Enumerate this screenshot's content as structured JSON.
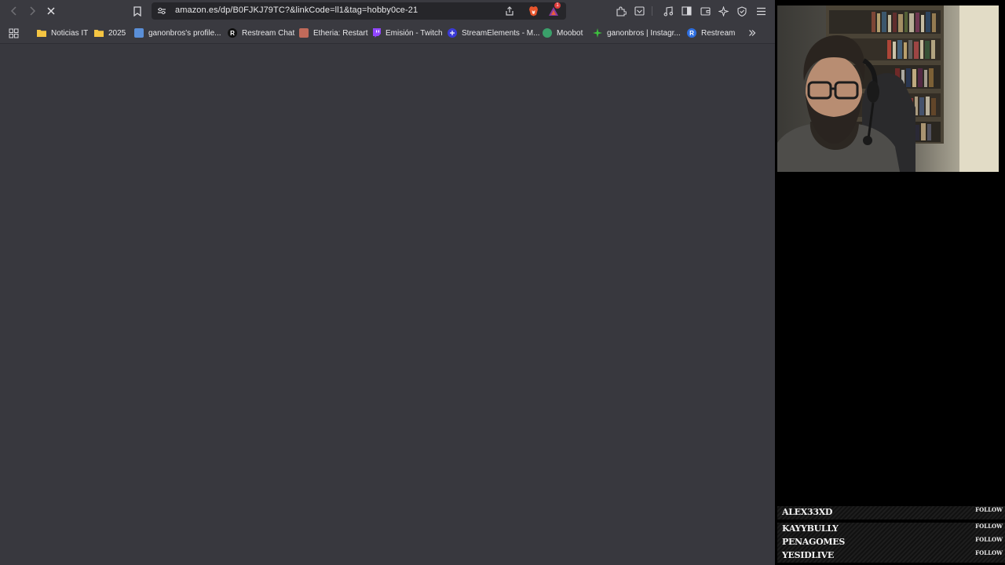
{
  "browser": {
    "url": "amazon.es/dp/B0FJKJ79TC?&linkCode=ll1&tag=hobby0ce-21",
    "extension_badge": "1"
  },
  "bookmarks": [
    {
      "label": "Noticias IT",
      "icon": "folder-icon",
      "color": "#f5c542"
    },
    {
      "label": "2025",
      "icon": "folder-icon",
      "color": "#f5c542"
    },
    {
      "label": "ganonbros's profile...",
      "icon": "site-icon",
      "color": "#5a8fd8"
    },
    {
      "label": "Restream Chat",
      "icon": "restream-icon",
      "color": "#111111"
    },
    {
      "label": "Etheria: Restart",
      "icon": "game-icon",
      "color": "#c06a5a"
    },
    {
      "label": "Emisión - Twitch",
      "icon": "twitch-icon",
      "color": "#9146ff"
    },
    {
      "label": "StreamElements - M...",
      "icon": "streamelements-icon",
      "color": "#3b3bd8"
    },
    {
      "label": "Moobot",
      "icon": "moobot-icon",
      "color": "#3aa06a"
    },
    {
      "label": "ganonbros | Instagr...",
      "icon": "instagram-icon",
      "color": "#3ec23e"
    },
    {
      "label": "Restream",
      "icon": "restream-icon",
      "color": "#2e6fe0"
    }
  ],
  "followers": [
    {
      "name": "ALEX33XD",
      "tag": "FOLLOW"
    },
    {
      "name": "KAYYBULLY",
      "tag": "FOLLOW"
    },
    {
      "name": "PENAGOMES",
      "tag": "FOLLOW"
    },
    {
      "name": "YESIDLIVE",
      "tag": "FOLLOW"
    }
  ]
}
